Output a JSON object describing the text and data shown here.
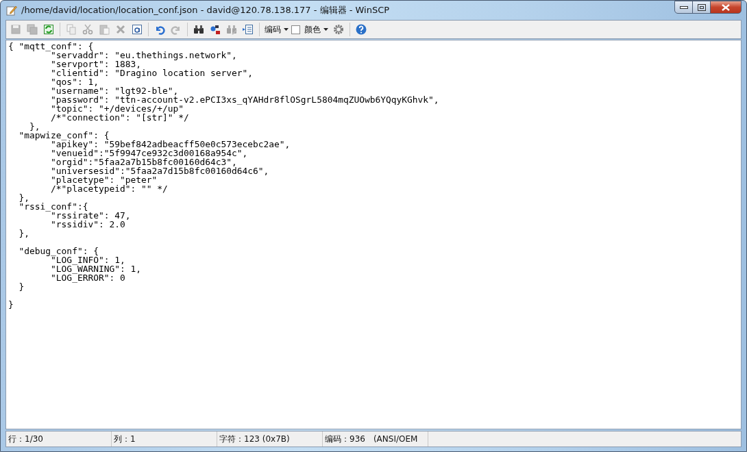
{
  "window": {
    "title": "/home/david/location/location_conf.json - david@120.78.138.177 - 编辑器 - WinSCP"
  },
  "toolbar": [
    {
      "kind": "button",
      "disabled": true
    },
    {
      "kind": "button",
      "disabled": true
    },
    {
      "kind": "button",
      "disabled": false
    },
    {
      "kind": "separator"
    },
    {
      "kind": "button",
      "disabled": true
    },
    {
      "kind": "button",
      "disabled": true
    },
    {
      "kind": "button",
      "disabled": true
    },
    {
      "kind": "button",
      "disabled": true
    },
    {
      "kind": "button",
      "disabled": false
    },
    {
      "kind": "separator"
    },
    {
      "kind": "button",
      "disabled": false
    },
    {
      "kind": "button",
      "disabled": true
    },
    {
      "kind": "separator"
    },
    {
      "kind": "button",
      "disabled": false
    },
    {
      "kind": "button",
      "disabled": false
    },
    {
      "kind": "button",
      "disabled": true
    },
    {
      "kind": "button",
      "disabled": false
    },
    {
      "kind": "separator"
    },
    {
      "kind": "dropdown",
      "label": "编码"
    },
    {
      "kind": "check-dropdown",
      "label": "颜色",
      "checked": false
    },
    {
      "kind": "button",
      "disabled": false
    },
    {
      "kind": "separator"
    },
    {
      "kind": "button",
      "disabled": false
    }
  ],
  "editor": {
    "blocks": [
      [
        "{ \"mqtt_conf\": {",
        "        \"servaddr\": \"eu.thethings.network\",",
        "        \"servport\": 1883,",
        "        \"clientid\": \"Dragino location server\",",
        "        \"qos\": 1,",
        "        \"username\": \"lgt92-ble\",",
        "        \"password\": \"ttn-account-v2.ePCI3xs_qYAHdr8flOSgrL5804mqZUOwb6YQqyKGhvk\",",
        "        \"topic\": \"+/devices/+/up\"",
        "        /*\"connection\": \"[str]\" */",
        "    },",
        "  \"mapwize_conf\": {",
        "        \"apikey\": \"59bef842adbeacff50e0c573ecebc2ae\",",
        "        \"venueid\":\"5f9947ce932c3d00168a954c\",",
        "        \"orgid\":\"5faa2a7b15b8fc00160d64c3\",",
        "        \"universesid\":\"5faa2a7d15b8fc00160d64c6\",",
        "        \"placetype\": \"peter\"",
        "        /*\"placetypeid\": \"\" */",
        "  },",
        "  \"rssi_conf\":{",
        "        \"rssirate\": 47,",
        "        \"rssidiv\": 2.0",
        "  },"
      ],
      [
        "  \"debug_conf\": {",
        "        \"LOG_INFO\": 1,",
        "        \"LOG_WARNING\": 1,",
        "        \"LOG_ERROR\": 0",
        "  }"
      ],
      [
        "}"
      ]
    ]
  },
  "status_bar": [
    "行：1/30",
    "列：1",
    "字符：123 (0x7B)",
    "编码：936　(ANSI/OEM"
  ]
}
